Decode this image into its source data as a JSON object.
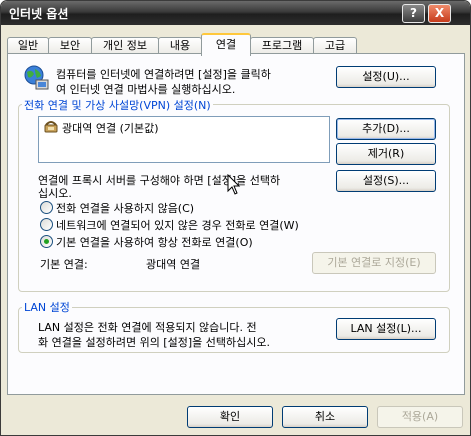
{
  "window": {
    "title": "인터넷 옵션",
    "help_glyph": "?",
    "close_glyph": "X"
  },
  "tabs": [
    {
      "label": "일반"
    },
    {
      "label": "보안"
    },
    {
      "label": "개인 정보"
    },
    {
      "label": "내용"
    },
    {
      "label": "연결",
      "active": true
    },
    {
      "label": "프로그램"
    },
    {
      "label": "고급"
    }
  ],
  "setup": {
    "line1": "컴퓨터를 인터넷에 연결하려면 [설정]을 클릭하",
    "line2": "여 인터넷 연결 마법사를 실행하십시오.",
    "button": "설정(U)..."
  },
  "dialup": {
    "legend": "전화 연결 및 가상 사설망(VPN) 설정(N)",
    "entries": [
      {
        "label": "광대역 연결 (기본값)"
      }
    ],
    "add_button": "추가(D)...",
    "remove_button": "제거(R)",
    "settings_button": "설정(S)...",
    "proxy_line1": "연결에 프록시 서버를 구성해야 하면 [설정]을 선택하",
    "proxy_line2": "십시오.",
    "radio_never": "전화 연결을 사용하지 않음(C)",
    "radio_when_no_network": "네트워크에 연결되어 있지 않은 경우 전화로 연결(W)",
    "radio_always": "기본 연결을 사용하여 항상 전화로 연결(O)",
    "selected": "radio_always",
    "default_label": "기본 연결:",
    "default_value": "광대역 연결",
    "set_default_button": "기본 연결로 지정(E)"
  },
  "lan": {
    "legend": "LAN 설정",
    "line1": "LAN 설정은 전화 연결에 적용되지 않습니다. 전",
    "line2": "화 연결을 설정하려면 위의 [설정]을 선택하십시오.",
    "button": "LAN 설정(L)..."
  },
  "footer": {
    "ok": "확인",
    "cancel": "취소",
    "apply": "적용(A)"
  }
}
